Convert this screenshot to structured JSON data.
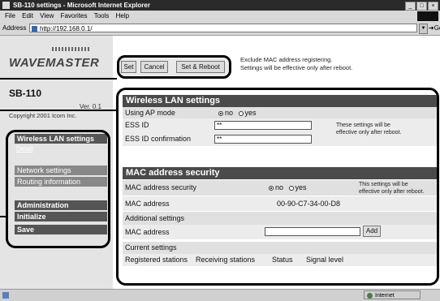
{
  "window": {
    "title": "SB-110 settings - Microsoft Internet Explorer",
    "controls": [
      "_",
      "□",
      "×"
    ]
  },
  "menubar": {
    "items": [
      "File",
      "Edit",
      "View",
      "Favorites",
      "Tools",
      "Help"
    ]
  },
  "addressbar": {
    "label": "Address",
    "url": "http://192.168.0.1/",
    "go_label": "Go"
  },
  "sidebar": {
    "logo": "WAVEMASTER",
    "model": "SB-110",
    "version": "Ver. 0.1",
    "copyright": "Copyright 2001 Icom Inc.",
    "nav": {
      "wireless": "Wireless LAN settings",
      "detail": "Detail",
      "network": "Network settings",
      "routing": "Routing information",
      "administration": "Administration",
      "initialize": "Initialize",
      "save": "Save"
    }
  },
  "toolbar": {
    "set_label": "Set",
    "cancel_label": "Cancel",
    "set_reboot_label": "Set & Reboot",
    "note_line1": "Exclude MAC address registering.",
    "note_line2": "Settings will be effective only after reboot."
  },
  "wireless": {
    "heading": "Wireless LAN settings",
    "ap_mode_label": "Using AP mode",
    "ap_mode_options": [
      "no",
      "yes"
    ],
    "ap_mode_selected": "no",
    "essid_label": "ESS ID",
    "essid_value": "**",
    "essid_confirm_label": "ESS ID confirmation",
    "essid_confirm_value": "**",
    "note_line1": "These settings will be",
    "note_line2": "effective only after reboot."
  },
  "mac": {
    "heading": "MAC address security",
    "security_label": "MAC address security",
    "security_options": [
      "no",
      "yes"
    ],
    "security_selected": "no",
    "note_line1": "This settings will be",
    "note_line2": "effective only after reboot.",
    "mac_label": "MAC address",
    "mac_value": "00-90-C7-34-00-D8",
    "additional_label": "Additional settings",
    "mac_input_label": "MAC address",
    "mac_input_value": "",
    "add_label": "Add",
    "current_label": "Current settings",
    "columns": [
      "Registered stations",
      "Receiving stations",
      "Status",
      "Signal level"
    ]
  },
  "statusbar": {
    "zone": "Internet"
  }
}
